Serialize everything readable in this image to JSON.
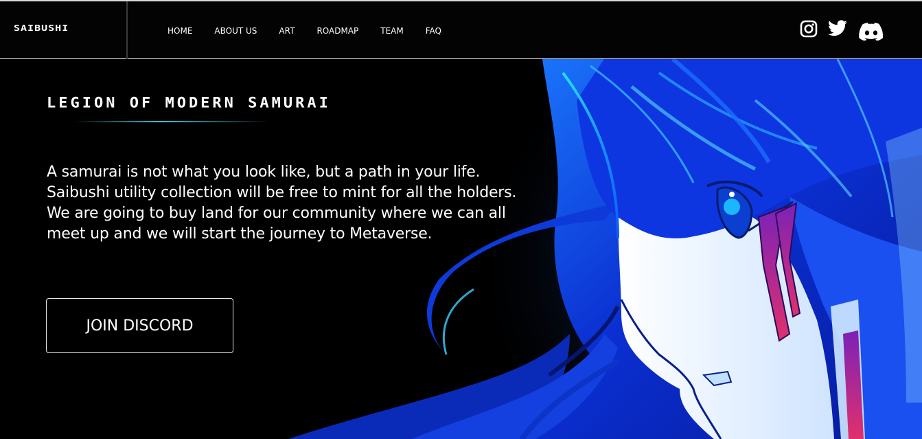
{
  "brand": {
    "name": "SAIBUSHI"
  },
  "nav": {
    "items": [
      {
        "label": "HOME"
      },
      {
        "label": "ABOUT US"
      },
      {
        "label": "ART"
      },
      {
        "label": "ROADMAP"
      },
      {
        "label": "TEAM"
      },
      {
        "label": "FAQ"
      }
    ]
  },
  "social": {
    "icons": [
      "instagram-icon",
      "twitter-icon",
      "discord-icon"
    ]
  },
  "hero": {
    "title": "LEGION OF MODERN SAMURAI",
    "description": "A samurai is not what you look like, but a path in your life. Saibushi utility collection will be free to mint for all the holders. We are going to buy land for our community where we can all meet up and we will start the journey to Metaverse.",
    "cta_label": "JOIN DISCORD"
  },
  "colors": {
    "background": "#000000",
    "accent_cyan": "#33d1e6",
    "hair_blue": "#0a2fd6",
    "mark_purple": "#8a1fa8"
  }
}
